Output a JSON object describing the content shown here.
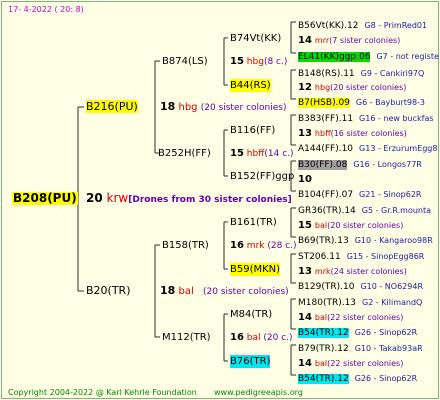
{
  "header": {
    "text": "17-   4-2022  (  20:   8)"
  },
  "footer": {
    "copyright": "Copyright 2004-2022 @ Karl Kehrle Foundation",
    "site": "www.pedigreeapis.org"
  },
  "root": {
    "name": "B208(PU)",
    "gen": "20",
    "code": "krw",
    "note": "[Drones from 30 sister colonies]"
  },
  "gen1": [
    {
      "name": "B216(PU)",
      "gen": "18",
      "code": "hbg",
      "note": "(20 sister colonies)"
    },
    {
      "name": "B20(TR)",
      "gen": "18",
      "code": "bal",
      "note": "(20 sister colonies)"
    }
  ],
  "gen2": [
    {
      "name": "B874(LS)",
      "gen": "15",
      "code": "hbg",
      "note": "(8 c.)"
    },
    {
      "name": "B252H(FF)",
      "gen": "15",
      "code": "hbff",
      "note": "(14 c.)"
    },
    {
      "name": "B158(TR)",
      "gen": "16",
      "code": "mrk",
      "note": "(28 c.)"
    },
    {
      "name": "M112(TR)",
      "gen": "16",
      "code": "bal",
      "note": "(20 c.)"
    }
  ],
  "gen3": [
    {
      "name": "B74Vt(KK)"
    },
    {
      "name": "B44(RS)"
    },
    {
      "name": "B116(FF)"
    },
    {
      "name": "B152(FF)ggp"
    },
    {
      "name": "B161(TR)"
    },
    {
      "name": "B59(MKN)"
    },
    {
      "name": "M84(TR)"
    },
    {
      "name": "B76(TR)"
    }
  ],
  "gen4": [
    {
      "name": "B56Vt(KK).12",
      "link": "G8 - PrimRed01"
    },
    {
      "gen": "14",
      "code": "mrr",
      "note": "(7 sister colonies)"
    },
    {
      "name": "EL41(KK)ggp.06",
      "link": "G7 - not registe"
    },
    {
      "name": "B148(RS).11",
      "link": "G9 - Cankiri97Q"
    },
    {
      "gen": "12",
      "code": "hbg",
      "note": "(20 sister colonies)"
    },
    {
      "name": "B7(HSB).09",
      "link": "G6 - Bayburt98-3"
    },
    {
      "name": "B383(FF).11",
      "link": "G16 - new buckfas"
    },
    {
      "gen": "13",
      "code": "hbff",
      "note": "(16 sister colonies)"
    },
    {
      "name": "A144(FF).10",
      "link": "G13 - ErzurumEgg8"
    },
    {
      "name": "B30(FF).08",
      "link": "G16 - Longos77R"
    },
    {
      "gen": "10",
      "code": "",
      "note": ""
    },
    {
      "name": "B104(FF).07",
      "link": "G21 - Sinop62R"
    },
    {
      "name": "GR36(TR).14",
      "link": "G5 - Gr.R.mounta"
    },
    {
      "gen": "15",
      "code": "bal",
      "note": "(20 sister colonies)"
    },
    {
      "name": "B69(TR).13",
      "link": "G10 - Kangaroo98R"
    },
    {
      "name": "ST206.11",
      "link": "G15 - SinopEgg86R"
    },
    {
      "gen": "13",
      "code": "mrk",
      "note": "(24 sister colonies)"
    },
    {
      "name": "B129(TR).10",
      "link": "G10 - NO6294R"
    },
    {
      "name": "M180(TR).13",
      "link": "G2 - KilimandQ"
    },
    {
      "gen": "14",
      "code": "bal",
      "note": "(22 sister colonies)"
    },
    {
      "name": "B54(TR).12",
      "link": "G26 - Sinop62R"
    },
    {
      "name": "B79(TR).12",
      "link": "G10 - Takab93aR"
    },
    {
      "gen": "14",
      "code": "bal",
      "note": "(22 sister colonies)"
    },
    {
      "name": "B54(TR).12",
      "link": "G26 - Sinop62R"
    }
  ]
}
